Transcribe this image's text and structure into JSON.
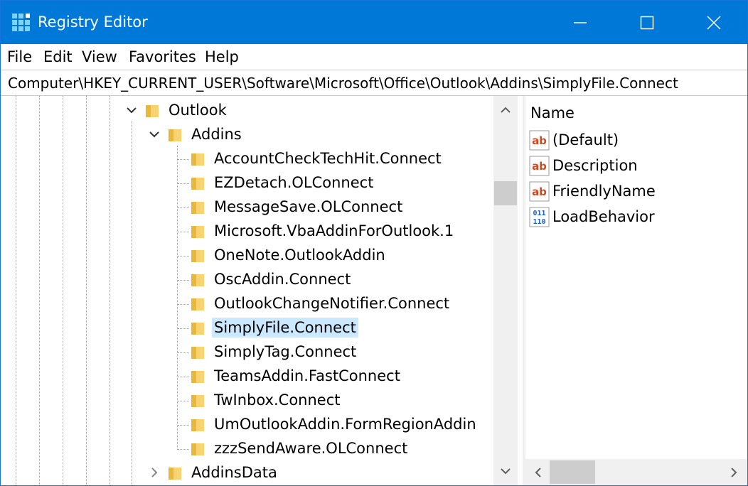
{
  "window": {
    "title": "Registry Editor"
  },
  "menu": {
    "file": "File",
    "edit": "Edit",
    "view": "View",
    "favorites": "Favorites",
    "help": "Help"
  },
  "address": {
    "path": "Computer\\HKEY_CURRENT_USER\\Software\\Microsoft\\Office\\Outlook\\Addins\\SimplyFile.Connect"
  },
  "tree": {
    "outlook": "Outlook",
    "addins": "Addins",
    "children": [
      "AccountCheckTechHit.Connect",
      "EZDetach.OLConnect",
      "MessageSave.OLConnect",
      "Microsoft.VbaAddinForOutlook.1",
      "OneNote.OutlookAddin",
      "OscAddin.Connect",
      "OutlookChangeNotifier.Connect",
      "SimplyFile.Connect",
      "SimplyTag.Connect",
      "TeamsAddin.FastConnect",
      "TwInbox.Connect",
      "UmOutlookAddin.FormRegionAddin",
      "zzzSendAware.OLConnect"
    ],
    "addinsdata": "AddinsData",
    "selected": "SimplyFile.Connect"
  },
  "values": {
    "column_name": "Name",
    "rows": [
      {
        "name": "(Default)",
        "icon": "string-value-icon"
      },
      {
        "name": "Description",
        "icon": "string-value-icon"
      },
      {
        "name": "FriendlyName",
        "icon": "string-value-icon"
      },
      {
        "name": "LoadBehavior",
        "icon": "binary-value-icon"
      }
    ],
    "icon_text_string": "ab",
    "icon_text_binary_top": "011",
    "icon_text_binary_bottom": "110"
  },
  "colors": {
    "titlebar": "#0078d7",
    "selection": "#cce8ff",
    "folder": "#f7d471",
    "string_icon": "#d24a1f",
    "binary_icon": "#1f5fbf"
  }
}
